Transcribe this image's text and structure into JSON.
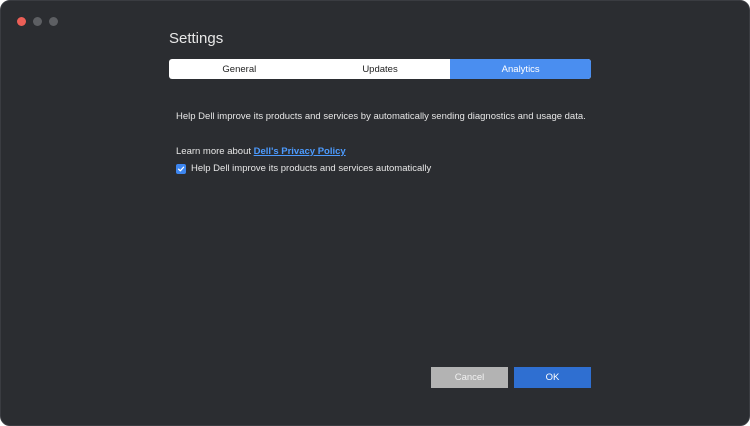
{
  "window": {
    "title": "Settings"
  },
  "tabs": [
    {
      "label": "General",
      "active": false
    },
    {
      "label": "Updates",
      "active": false
    },
    {
      "label": "Analytics",
      "active": true
    }
  ],
  "analytics": {
    "description": "Help Dell improve its products and services by automatically sending diagnostics and usage data.",
    "learn_more_prefix": "Learn more about ",
    "privacy_link": "Dell's Privacy Policy",
    "checkbox_label": "Help Dell improve its products and services automatically",
    "checkbox_checked": true
  },
  "buttons": {
    "cancel": "Cancel",
    "ok": "OK"
  },
  "colors": {
    "window_bg": "#2b2d31",
    "accent": "#4a8ef0",
    "ok_button": "#2f6fd1",
    "cancel_button": "#b3b3b3",
    "link": "#4c9bff",
    "close_dot": "#ec5f57"
  }
}
